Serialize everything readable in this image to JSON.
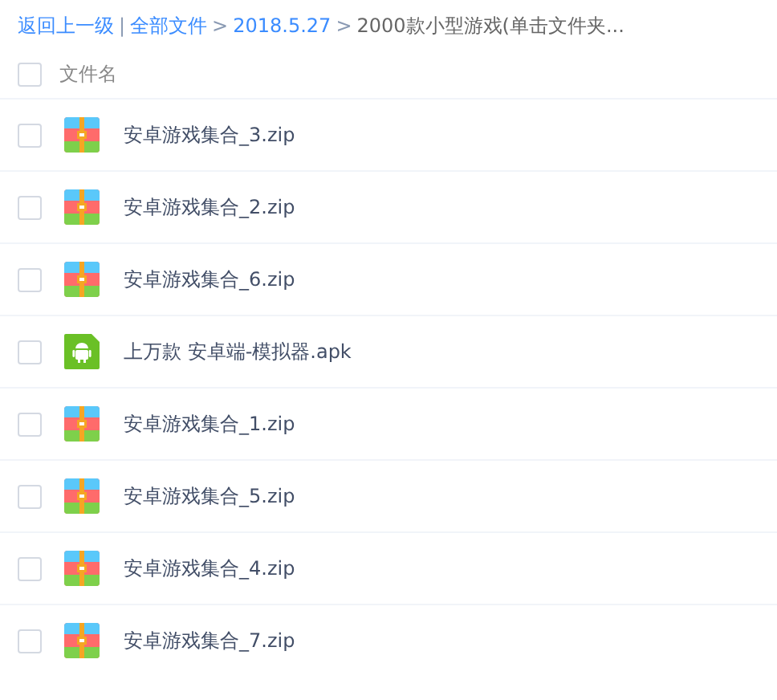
{
  "breadcrumb": [
    {
      "kind": "link",
      "label": "返回上一级"
    },
    {
      "kind": "separator",
      "label": "|"
    },
    {
      "kind": "link",
      "label": "全部文件"
    },
    {
      "kind": "separator",
      "label": ">"
    },
    {
      "kind": "link",
      "label": "2018.5.27"
    },
    {
      "kind": "separator",
      "label": ">"
    },
    {
      "kind": "current",
      "label": "2000款小型游戏(单击文件夹..."
    }
  ],
  "header": {
    "checked": false,
    "label": "文件名"
  },
  "files": [
    {
      "name": "安卓游戏集合_3.zip",
      "kind": "zip",
      "checked": false
    },
    {
      "name": "安卓游戏集合_2.zip",
      "kind": "zip",
      "checked": false
    },
    {
      "name": "安卓游戏集合_6.zip",
      "kind": "zip",
      "checked": false
    },
    {
      "name": "上万款 安卓端-模拟器.apk",
      "kind": "apk",
      "checked": false
    },
    {
      "name": "安卓游戏集合_1.zip",
      "kind": "zip",
      "checked": false
    },
    {
      "name": "安卓游戏集合_5.zip",
      "kind": "zip",
      "checked": false
    },
    {
      "name": "安卓游戏集合_4.zip",
      "kind": "zip",
      "checked": false
    },
    {
      "name": "安卓游戏集合_7.zip",
      "kind": "zip",
      "checked": false
    }
  ]
}
